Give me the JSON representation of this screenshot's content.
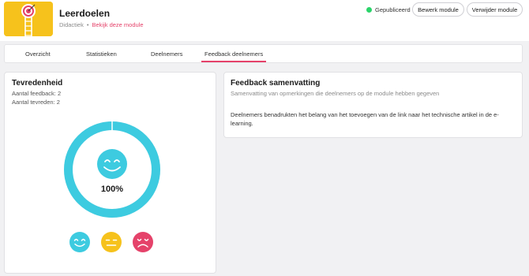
{
  "module": {
    "title": "Leerdoelen",
    "category": "Didactiek",
    "separator": "•",
    "view_link": "Bekijk deze module",
    "status": "Gepubliceerd",
    "edit_label": "Bewerk module",
    "delete_label": "Verwijder module",
    "thumbnail_icon": "target-ladder-illustration"
  },
  "tabs": [
    {
      "label": "Overzicht",
      "active": false
    },
    {
      "label": "Statistieken",
      "active": false
    },
    {
      "label": "Deelnemers",
      "active": false
    },
    {
      "label": "Feedback deelnemers",
      "active": true
    }
  ],
  "satisfaction": {
    "title": "Tevredenheid",
    "feedback_count_label": "Aantal feedback: 2",
    "satisfied_count_label": "Aantal tevreden: 2",
    "percent_label": "100%",
    "percent_value": 100,
    "ring_color": "#3dcbe0",
    "faces": [
      {
        "name": "happy",
        "color": "#3dcbe0"
      },
      {
        "name": "neutral",
        "color": "#f6c21c"
      },
      {
        "name": "sad",
        "color": "#e5426a"
      }
    ]
  },
  "summary": {
    "title": "Feedback samenvatting",
    "subtitle": "Samenvatting van opmerkingen die deelnemers op de module hebben gegeven",
    "text": "Deelnemers benadrukten het belang van het toevoegen van de link naar het technische artikel in de e-learning."
  },
  "colors": {
    "accent": "#e5426a",
    "published": "#2bd46a"
  }
}
